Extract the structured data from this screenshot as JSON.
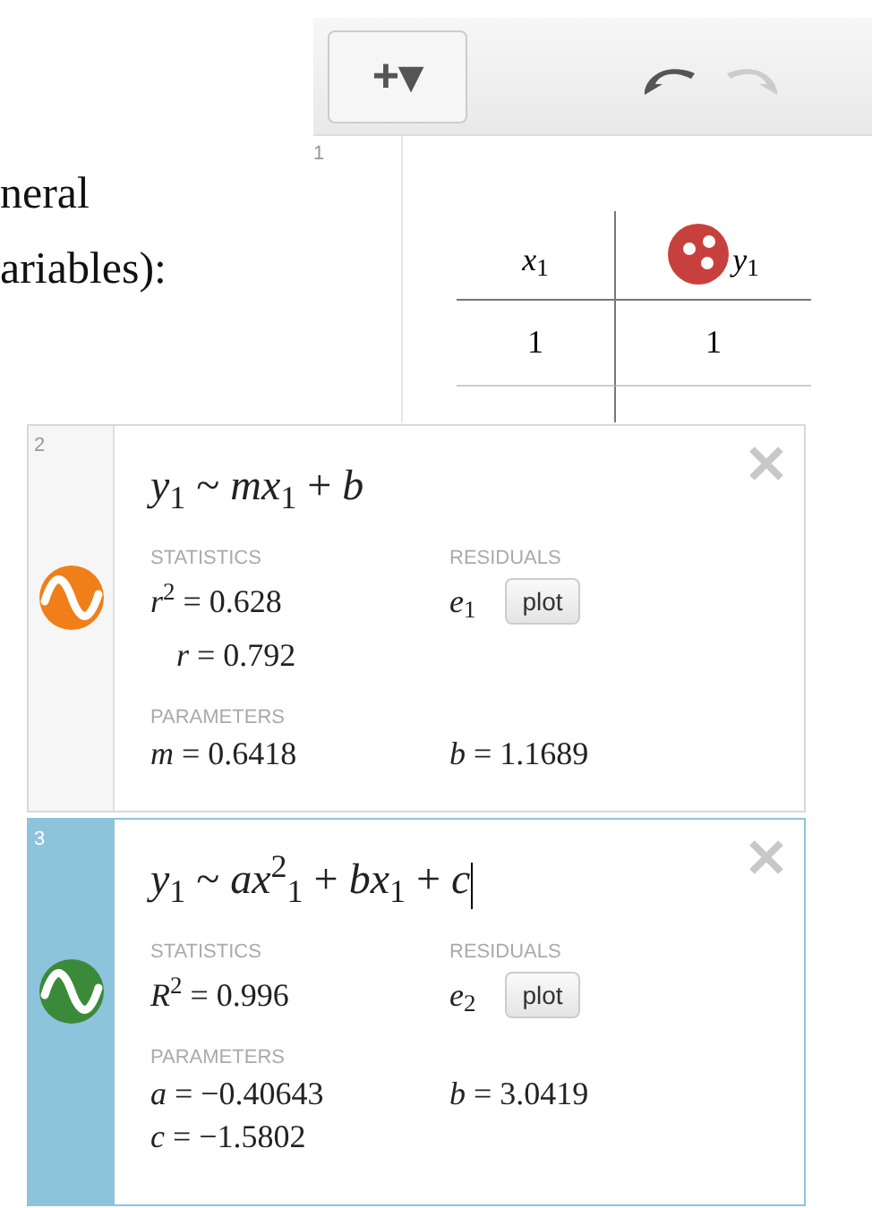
{
  "document": {
    "lines": [
      "neral",
      "ariables):"
    ]
  },
  "toolbar": {
    "add_button": "+▾"
  },
  "table_row": {
    "number": "1",
    "columns": [
      "*x*$_{1}$",
      "*y*$_{1}$"
    ],
    "rows": [
      [
        "1",
        "1"
      ]
    ]
  },
  "expressions": [
    {
      "number": "2",
      "selected": false,
      "cursor": false,
      "color": "#f07f1a",
      "formula": "*y*$_{1}$ ~ *mx*$_{1}$ + *b*",
      "statistics_label": "STATISTICS",
      "statistics": [
        "*r*$^{2}$ = 0.628",
        " *r* = 0.792"
      ],
      "residuals_label": "RESIDUALS",
      "residual": "*e*$_{1}$",
      "plot_button": "plot",
      "parameters_label": "PARAMETERS",
      "parameters": [
        "*m* = 0.6418",
        "*b* = 1.1689"
      ]
    },
    {
      "number": "3",
      "selected": true,
      "cursor": true,
      "color": "#3a8a3a",
      "formula": "*y*$_{1}$ ~ *ax*$^{2}$$_{1}$ + *bx*$_{1}$ + *c*",
      "statistics_label": "STATISTICS",
      "statistics": [
        "*R*$^{2}$ = 0.996"
      ],
      "residuals_label": "RESIDUALS",
      "residual": "*e*$_{2}$",
      "plot_button": "plot",
      "parameters_label": "PARAMETERS",
      "parameters": [
        "*a* = −0.40643",
        "*b* = 3.0419",
        "*c* = −1.5802"
      ]
    }
  ]
}
